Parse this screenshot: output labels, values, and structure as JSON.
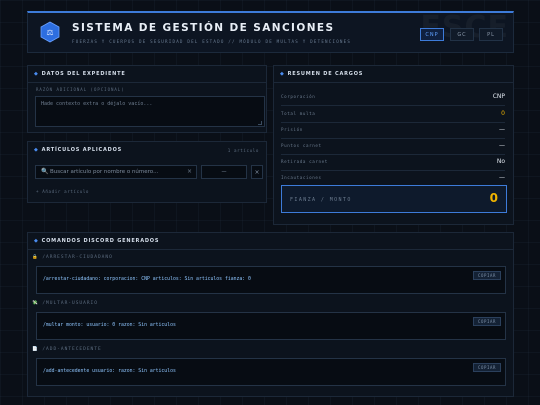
{
  "header": {
    "title": "SISTEMA DE GESTIÓN DE SANCIONES",
    "subtitle": "FUERZAS Y CUERPOS DE SEGURIDAD DEL ESTADO // MÓDULO DE MULTAS Y DETENCIONES",
    "watermark": "FSCE",
    "corps": [
      {
        "label": "CNP",
        "active": true
      },
      {
        "label": "GC",
        "active": false
      },
      {
        "label": "PL",
        "active": false
      }
    ]
  },
  "expediente": {
    "title": "DATOS DEL EXPEDIENTE",
    "razon_label": "RAZÓN ADICIONAL (OPCIONAL)",
    "razon_placeholder": "Hade contexto extra o déjalo vacío..."
  },
  "articulos": {
    "title": "ARTÍCULOS APLICADOS",
    "count": "1 artículo",
    "search_placeholder": "Buscar artículo por nombre o número...",
    "select_value": "—",
    "add_label": "+ Añadir artículo"
  },
  "resumen": {
    "title": "RESUMEN DE CARGOS",
    "rows": [
      {
        "key": "Corporación",
        "value": "CNP"
      },
      {
        "key": "Total multa",
        "value": "0"
      },
      {
        "key": "Prisión",
        "value": "—"
      },
      {
        "key": "Puntos carnet",
        "value": "—"
      },
      {
        "key": "Retirada carnet",
        "value": "No"
      },
      {
        "key": "Incautaciones",
        "value": "—"
      }
    ],
    "fianza_label": "FIANZA / MONTO",
    "fianza_value": "0"
  },
  "comandos": {
    "title": "COMANDOS DISCORD GENERADOS",
    "copy_label": "COPIAR",
    "items": [
      {
        "section": "/ARRESTAR-CIUDADANO",
        "text": "/arrestar-ciudadano: corporacion: CNP articulos: Sin articulos fianza: 0"
      },
      {
        "section": "/MULTAR-USUARIO",
        "text": "/multar monto: usuario: 0 razon: Sin articulos"
      },
      {
        "section": "/ADD-ANTECEDENTE",
        "text": "/add-antecedente usuario: razon: Sin articulos"
      }
    ]
  },
  "colors": {
    "accent": "#3d7bd9",
    "money": "#f0b400",
    "command": "#8fc6ff"
  }
}
